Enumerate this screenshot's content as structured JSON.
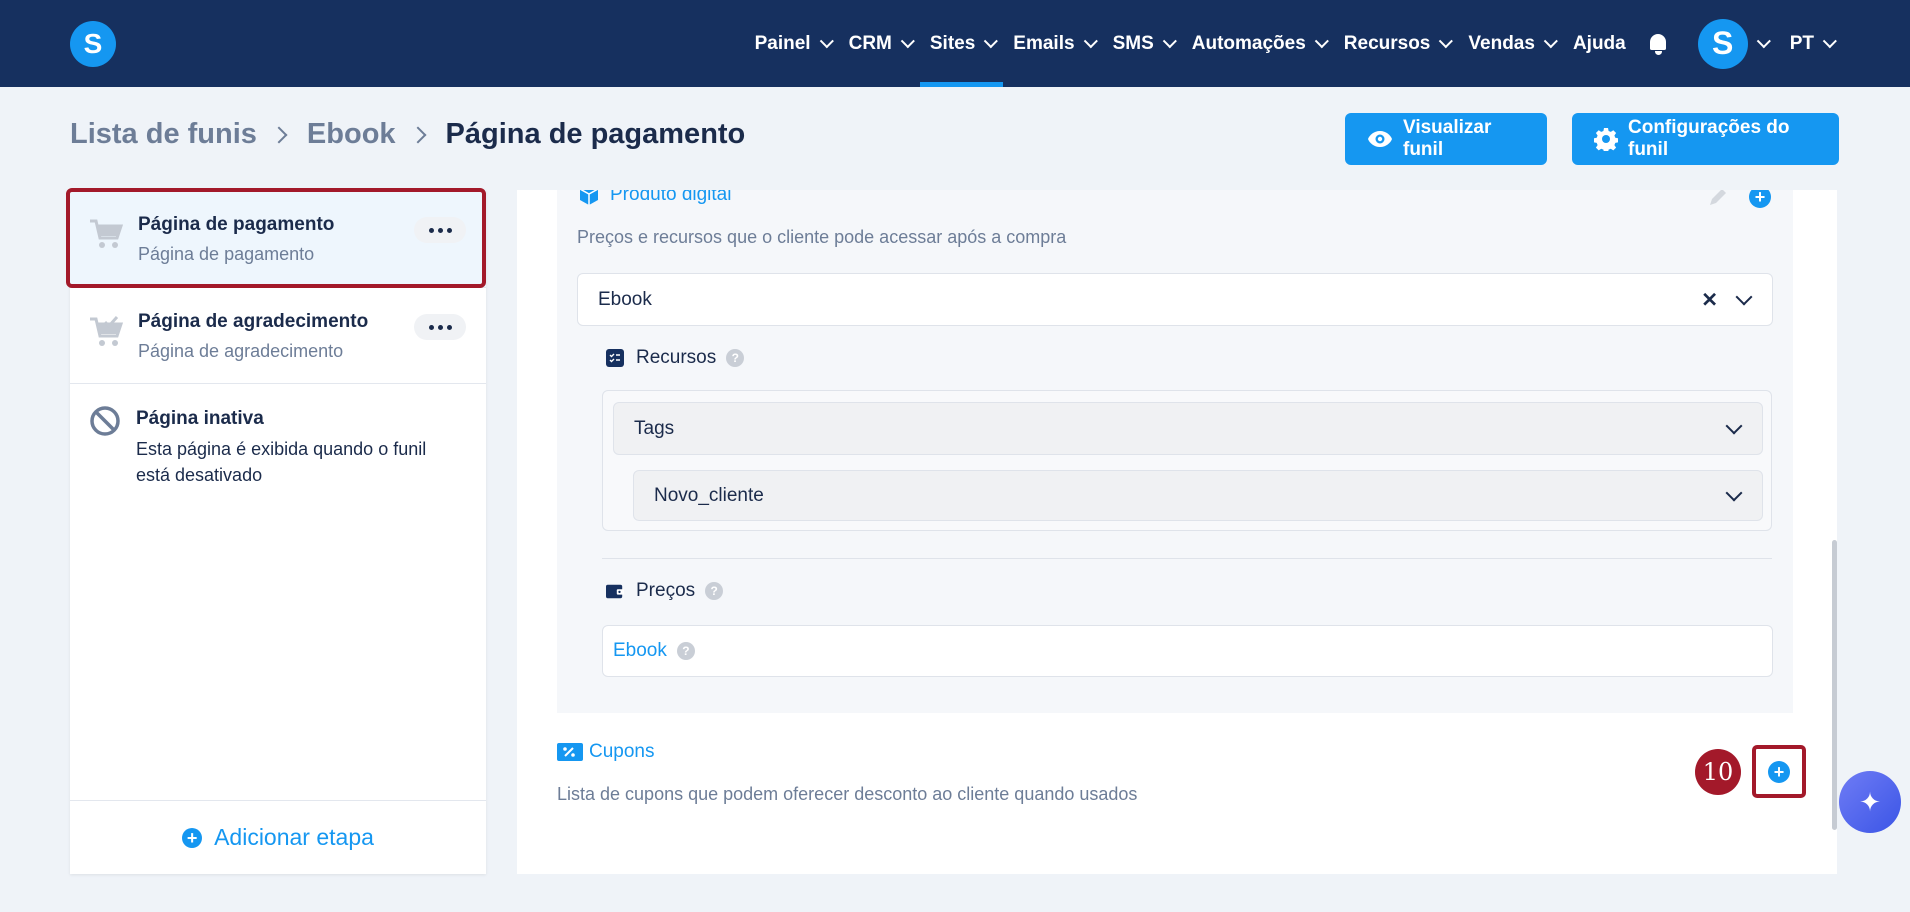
{
  "nav": {
    "items": [
      {
        "label": "Painel",
        "dropdown": true,
        "active": false
      },
      {
        "label": "CRM",
        "dropdown": true,
        "active": false
      },
      {
        "label": "Sites",
        "dropdown": true,
        "active": true
      },
      {
        "label": "Emails",
        "dropdown": true,
        "active": false
      },
      {
        "label": "SMS",
        "dropdown": true,
        "active": false
      },
      {
        "label": "Automações",
        "dropdown": true,
        "active": false
      },
      {
        "label": "Recursos",
        "dropdown": true,
        "active": false
      },
      {
        "label": "Vendas",
        "dropdown": true,
        "active": false
      },
      {
        "label": "Ajuda",
        "dropdown": false,
        "active": false
      }
    ],
    "logo_letter": "S",
    "avatar_letter": "S",
    "language": "PT"
  },
  "breadcrumb": {
    "items": [
      "Lista de funis",
      "Ebook"
    ],
    "current": "Página de pagamento"
  },
  "actions": {
    "preview": "Visualizar funil",
    "settings": "Configurações do funil"
  },
  "steps": {
    "items": [
      {
        "title": "Página de pagamento",
        "subtitle": "Página de pagamento"
      },
      {
        "title": "Página de agradecimento",
        "subtitle": "Página de agradecimento"
      },
      {
        "title": "Página inativa",
        "subtitle": "Esta página é exibida quando o funil está desativado"
      }
    ],
    "add_label": "Adicionar etapa"
  },
  "product": {
    "title": "Produto digital",
    "description": "Preços e recursos que o cliente pode acessar após a compra",
    "selected": "Ebook",
    "resources_label": "Recursos",
    "resource_type": "Tags",
    "resource_value": "Novo_cliente",
    "prices_label": "Preços",
    "price_item": "Ebook"
  },
  "coupons": {
    "title": "Cupons",
    "description": "Lista de cupons que podem oferecer desconto ao cliente quando usados"
  },
  "step_marker": "10",
  "colors": {
    "nav_bg": "#16305f",
    "accent": "#1597f1",
    "highlight": "#a3192a"
  }
}
